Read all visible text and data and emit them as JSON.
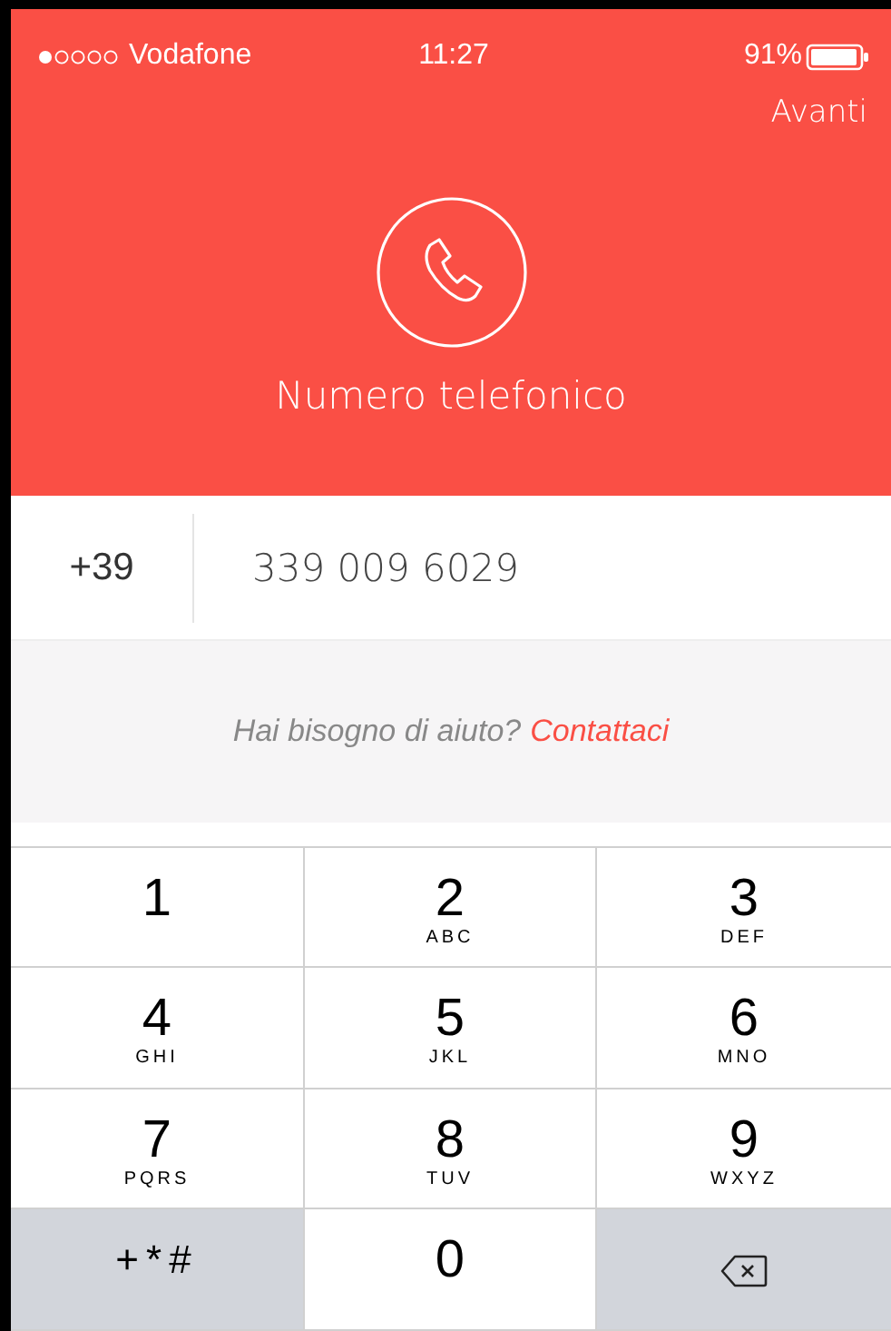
{
  "status_bar": {
    "carrier": "Vodafone",
    "time": "11:27",
    "battery": "91%"
  },
  "nav": {
    "next": "Avanti"
  },
  "title": "Numero telefonico",
  "phone": {
    "country_code": "+39",
    "number": "339 009 6029"
  },
  "help": {
    "text": "Hai bisogno di aiuto?",
    "link": "Contattaci"
  },
  "keypad": [
    {
      "kind": "digit",
      "digit": "1"
    },
    {
      "kind": "digit",
      "digit": "2",
      "letters": "ABC"
    },
    {
      "kind": "digit",
      "digit": "3",
      "letters": "DEF"
    },
    {
      "kind": "digit",
      "digit": "4",
      "letters": "GHI"
    },
    {
      "kind": "digit",
      "digit": "5",
      "letters": "JKL"
    },
    {
      "kind": "digit",
      "digit": "6",
      "letters": "MNO"
    },
    {
      "kind": "digit",
      "digit": "7",
      "letters": "PQRS"
    },
    {
      "kind": "digit",
      "digit": "8",
      "letters": "TUV"
    },
    {
      "kind": "digit",
      "digit": "9",
      "letters": "WXYZ"
    },
    {
      "kind": "symbols",
      "digit": "+*#"
    },
    {
      "kind": "digit",
      "digit": "0"
    },
    {
      "kind": "delete"
    }
  ]
}
